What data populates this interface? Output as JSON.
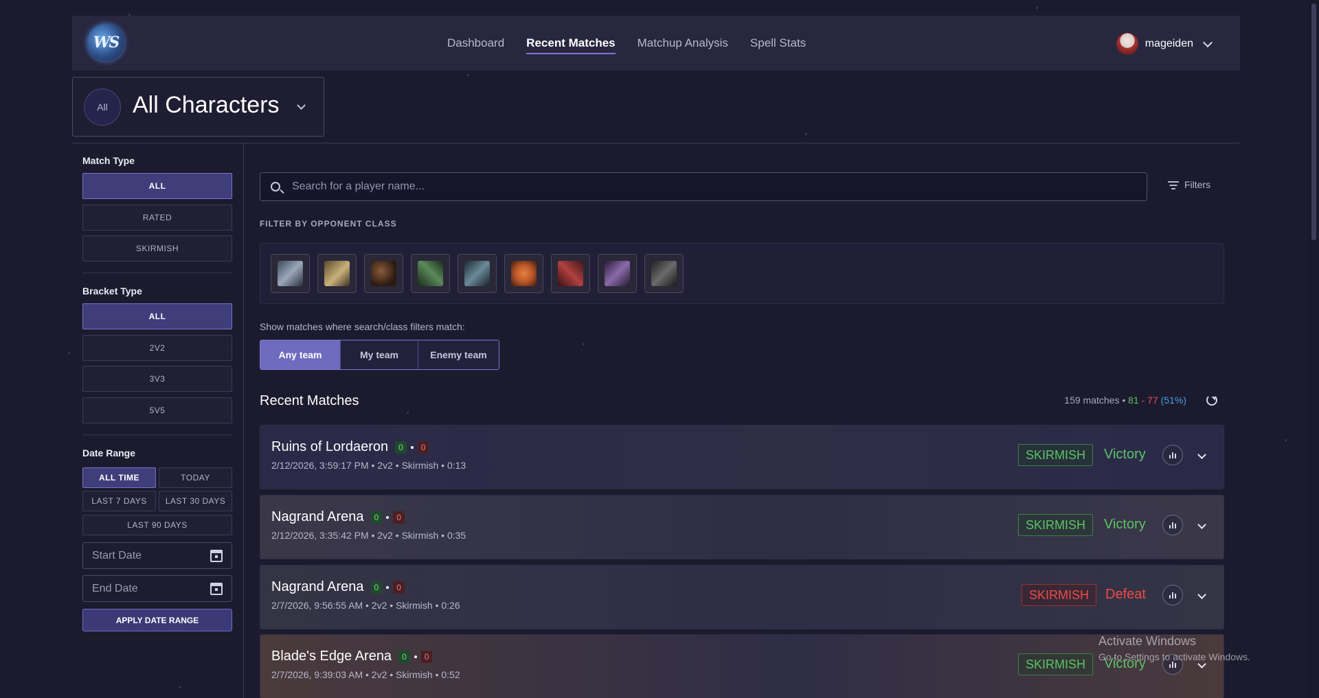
{
  "nav": {
    "logo_text": "WS",
    "links": [
      {
        "label": "Dashboard",
        "active": false
      },
      {
        "label": "Recent Matches",
        "active": true
      },
      {
        "label": "Matchup Analysis",
        "active": false
      },
      {
        "label": "Spell Stats",
        "active": false
      }
    ],
    "username": "mageiden"
  },
  "character_selector": {
    "badge": "All",
    "title": "All Characters"
  },
  "sidebar": {
    "match_type": {
      "label": "Match Type",
      "options": [
        "ALL",
        "RATED",
        "SKIRMISH"
      ],
      "selected": "ALL"
    },
    "bracket_type": {
      "label": "Bracket Type",
      "options": [
        "ALL",
        "2V2",
        "3V3",
        "5V5"
      ],
      "selected": "ALL"
    },
    "date_range": {
      "label": "Date Range",
      "options": [
        "ALL TIME",
        "TODAY",
        "LAST 7 DAYS",
        "LAST 30 DAYS",
        "LAST 90 DAYS"
      ],
      "selected": "ALL TIME",
      "start_placeholder": "Start Date",
      "end_placeholder": "End Date",
      "apply_label": "APPLY DATE RANGE"
    }
  },
  "search": {
    "placeholder": "Search for a player name...",
    "filters_label": "Filters"
  },
  "class_filter": {
    "label": "FILTER BY OPPONENT CLASS",
    "classes": [
      {
        "name": "warrior-icon",
        "color": "#9aa7b8"
      },
      {
        "name": "paladin-icon",
        "color": "#c9b27a"
      },
      {
        "name": "hunter-icon",
        "color": "#8a5a3a"
      },
      {
        "name": "rogue-icon",
        "color": "#5a8a5a"
      },
      {
        "name": "priest-icon",
        "color": "#6a8a9a"
      },
      {
        "name": "druid-icon",
        "color": "#c05a2a"
      },
      {
        "name": "shaman-icon",
        "color": "#b04040"
      },
      {
        "name": "warlock-icon",
        "color": "#8a6aa8"
      },
      {
        "name": "mage-icon",
        "color": "#6a6a6a"
      }
    ]
  },
  "team_filter": {
    "label": "Show matches where search/class filters match:",
    "options": [
      "Any team",
      "My team",
      "Enemy team"
    ],
    "selected": "Any team"
  },
  "recent_matches": {
    "title": "Recent Matches",
    "count_text": "159 matches",
    "wins": "81",
    "losses": "77",
    "pct": "(51%)",
    "matches": [
      {
        "arena": "Ruins of Lordaeron",
        "score_a": "0",
        "score_b": "0",
        "meta": "2/12/2026, 3:59:17 PM • 2v2 • Skirmish • 0:13",
        "type": "SKIRMISH",
        "result": "Victory",
        "win": true,
        "bg": "#2a2a48"
      },
      {
        "arena": "Nagrand Arena",
        "score_a": "0",
        "score_b": "0",
        "meta": "2/12/2026, 3:35:42 PM • 2v2 • Skirmish • 0:35",
        "type": "SKIRMISH",
        "result": "Victory",
        "win": true,
        "bg": "#3a3848"
      },
      {
        "arena": "Nagrand Arena",
        "score_a": "0",
        "score_b": "0",
        "meta": "2/7/2026, 9:56:55 AM • 2v2 • Skirmish • 0:26",
        "type": "SKIRMISH",
        "result": "Defeat",
        "win": false,
        "bg": "#353445"
      },
      {
        "arena": "Blade's Edge Arena",
        "score_a": "0",
        "score_b": "0",
        "meta": "2/7/2026, 9:39:03 AM • 2v2 • Skirmish • 0:52",
        "type": "SKIRMISH",
        "result": "Victory",
        "win": true,
        "bg": "#4a3a3c"
      }
    ]
  },
  "windows_watermark": {
    "line1": "Activate Windows",
    "line2": "Go to Settings to activate Windows."
  }
}
